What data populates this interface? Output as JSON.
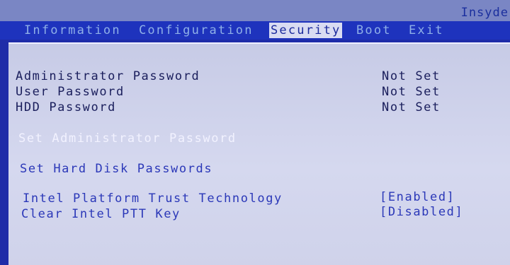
{
  "vendor": "Insyde",
  "menu": {
    "tabs": [
      {
        "label": "Information"
      },
      {
        "label": "Configuration"
      },
      {
        "label": "Security"
      },
      {
        "label": "Boot"
      },
      {
        "label": "Exit"
      }
    ]
  },
  "security": {
    "passwords": [
      {
        "label": "Administrator Password",
        "value": "Not Set"
      },
      {
        "label": "User Password",
        "value": "Not Set"
      },
      {
        "label": "HDD Password",
        "value": "Not Set"
      }
    ],
    "actions": [
      {
        "label": "Set Administrator Password"
      },
      {
        "label": "Set Hard Disk Passwords"
      }
    ],
    "options": [
      {
        "label": "Intel Platform Trust Technology",
        "value": "[Enabled]"
      },
      {
        "label": "Clear Intel PTT Key",
        "value": "[Disabled]"
      }
    ]
  },
  "colors": {
    "menubar": "#1e33bd",
    "active_tab_bg": "#d9dcf2",
    "content_bg": "#cfd2ea",
    "highlight_text": "#f2f2ff",
    "option_text": "#2b38b8"
  }
}
